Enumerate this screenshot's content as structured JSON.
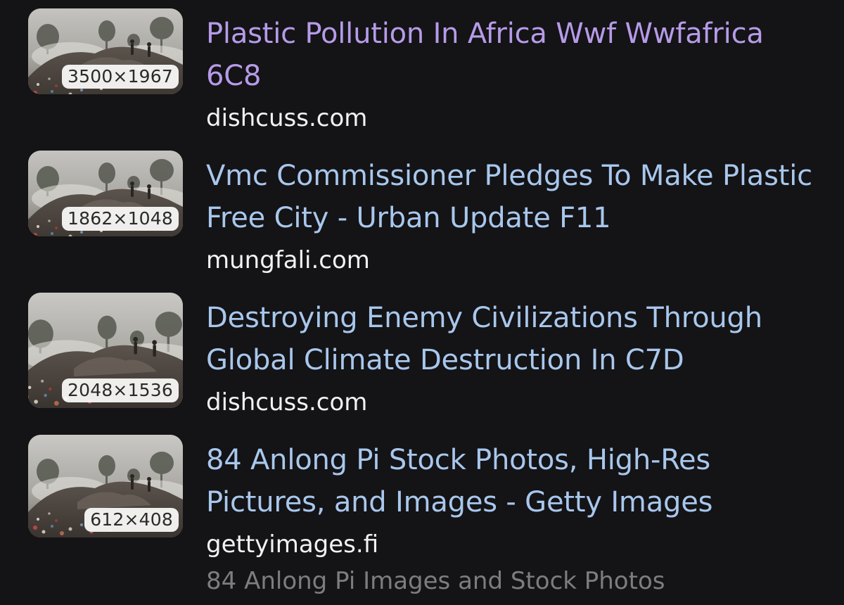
{
  "colors": {
    "background": "#141316",
    "link": "#a8c7ec",
    "visited_link": "#b69be8",
    "source": "#f2f2f2",
    "snippet": "#7d7d80"
  },
  "results": [
    {
      "dimensions": "3500×1967",
      "title": "Plastic Pollution In Africa Wwf Wwfafrica 6C8",
      "visited": true,
      "source": "dishcuss.com"
    },
    {
      "dimensions": "1862×1048",
      "title": "Vmc Commissioner Pledges To Make Plastic Free City - Urban Update F11",
      "visited": false,
      "source": "mungfali.com"
    },
    {
      "dimensions": "2048×1536",
      "title": "Destroying Enemy Civilizations Through Global Climate Destruction In C7D",
      "visited": false,
      "source": "dishcuss.com"
    },
    {
      "dimensions": "612×408",
      "title": "84 Anlong Pi Stock Photos, High-Res Pictures, and Images - Getty Images",
      "visited": false,
      "source": "gettyimages.fi",
      "snippet": "84 Anlong Pi Images and Stock Photos"
    }
  ]
}
